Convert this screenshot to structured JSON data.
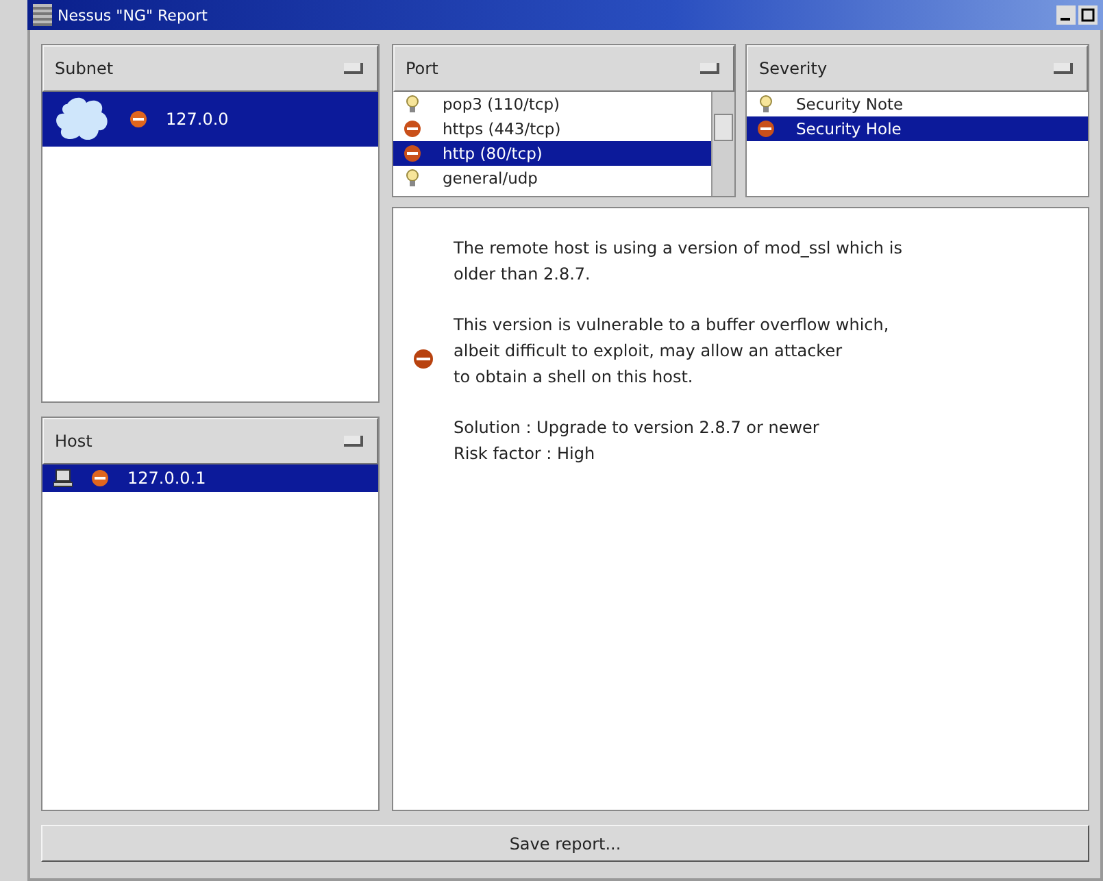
{
  "window": {
    "title": "Nessus \"NG\" Report"
  },
  "subnet": {
    "header": "Subnet",
    "items": [
      {
        "label": "127.0.0",
        "kind": "hole",
        "selected": true
      }
    ]
  },
  "host": {
    "header": "Host",
    "items": [
      {
        "label": "127.0.0.1",
        "kind": "hole",
        "selected": true
      }
    ]
  },
  "port": {
    "header": "Port",
    "items": [
      {
        "label": "pop3 (110/tcp)",
        "kind": "note",
        "selected": false
      },
      {
        "label": "https (443/tcp)",
        "kind": "hole",
        "selected": false
      },
      {
        "label": "http (80/tcp)",
        "kind": "hole",
        "selected": true
      },
      {
        "label": "general/udp",
        "kind": "note",
        "selected": false
      }
    ]
  },
  "severity": {
    "header": "Severity",
    "items": [
      {
        "label": "Security Note",
        "kind": "note",
        "selected": false
      },
      {
        "label": "Security Hole",
        "kind": "hole",
        "selected": true
      }
    ]
  },
  "report": {
    "kind": "hole",
    "paragraphs": [
      "The remote host is using a version of mod_ssl which is\nolder than 2.8.7.",
      "This version is vulnerable to a buffer overflow which,\nalbeit difficult to exploit, may allow an attacker\nto obtain a shell on this host.",
      "Solution : Upgrade to version 2.8.7 or newer\nRisk factor : High"
    ]
  },
  "buttons": [
    "Save report..."
  ]
}
